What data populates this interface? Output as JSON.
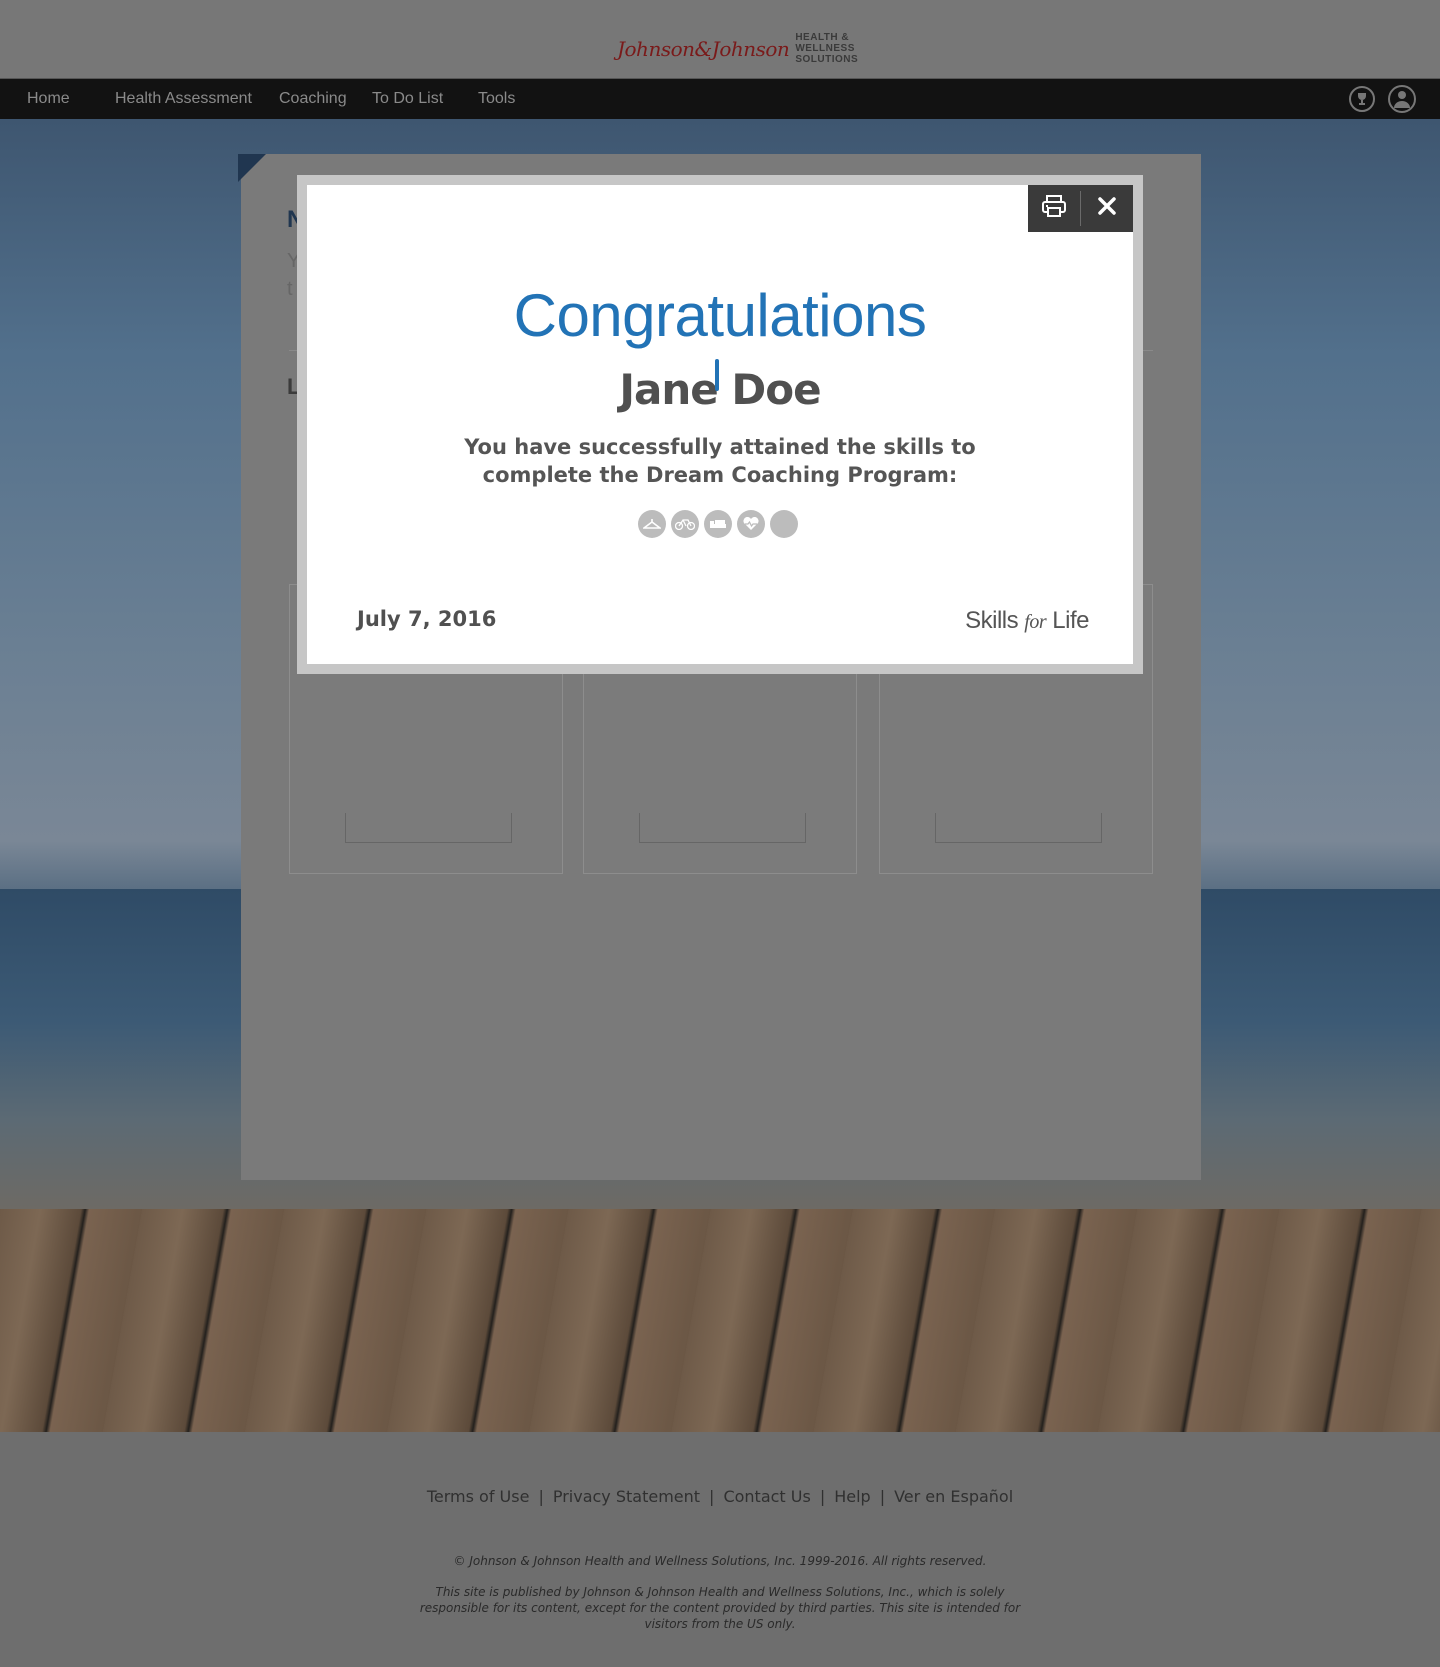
{
  "header": {
    "logo_script": "Johnson&Johnson",
    "logo_line1": "HEALTH &",
    "logo_line2": "WELLNESS",
    "logo_line3": "SOLUTIONS"
  },
  "nav": {
    "items": [
      {
        "label": "Home"
      },
      {
        "label": "Health Assessment"
      },
      {
        "label": "Coaching"
      },
      {
        "label": "To Do List"
      },
      {
        "label": "Tools"
      }
    ],
    "icons": [
      "trophy-icon",
      "user-icon"
    ]
  },
  "certificate": {
    "title": "Congratulations",
    "name": "Jane Doe",
    "message": "You have successfully attained the skills to complete the Dream Coaching Program:",
    "date": "July 7, 2016",
    "brand_pre": "Skills ",
    "brand_mid": "for",
    "brand_post": " Life",
    "badges": [
      "hanger-icon",
      "bike-icon",
      "bed-icon",
      "heart-icon",
      "blank-badge"
    ],
    "toolbar": {
      "print_icon": "print-icon",
      "close_icon": "close-icon"
    }
  },
  "footer": {
    "links": [
      "Terms of Use",
      "Privacy Statement",
      "Contact Us",
      "Help",
      "Ver en Español"
    ],
    "copyright": "© Johnson & Johnson Health and Wellness Solutions, Inc. 1999-2016. All rights reserved.",
    "disclaimer": "This site is published by Johnson & Johnson Health and Wellness Solutions, Inc., which is solely responsible for its content, except for the content provided by third parties.  This site is intended for visitors from the US only."
  },
  "colors": {
    "accent": "#2273b6",
    "nav_bg": "#121212",
    "overlay_bg": "#6e6e6e"
  }
}
